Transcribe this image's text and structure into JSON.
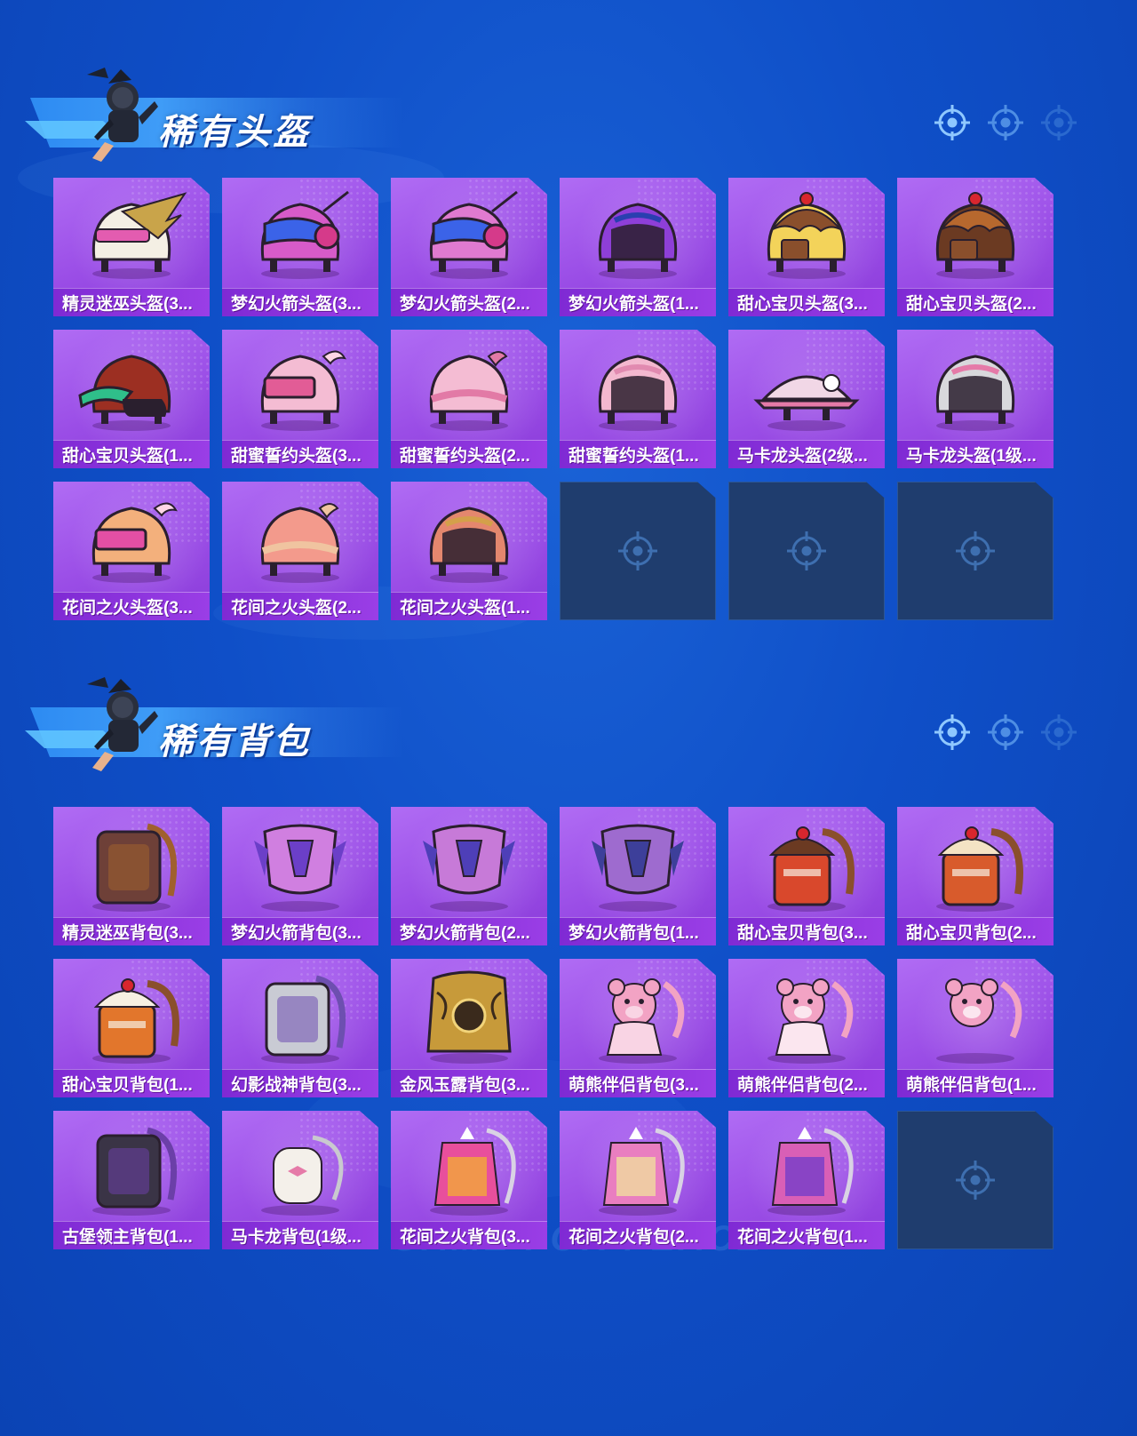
{
  "sections": [
    {
      "title": "稀有头盔",
      "items": [
        {
          "label": "精灵迷巫头盔(3...",
          "art": "helmet-wings",
          "c1": "#f4efe4",
          "c2": "#c9a44a"
        },
        {
          "label": "梦幻火箭头盔(3...",
          "art": "helmet-rocket",
          "c1": "#d75bc9",
          "c2": "#3b63e8"
        },
        {
          "label": "梦幻火箭头盔(2...",
          "art": "helmet-rocket",
          "c1": "#e07ad0",
          "c2": "#3b63e8"
        },
        {
          "label": "梦幻火箭头盔(1...",
          "art": "helmet-moto",
          "c1": "#8e3fd8",
          "c2": "#2a3fb0"
        },
        {
          "label": "甜心宝贝头盔(3...",
          "art": "helmet-cake",
          "c1": "#f3d35a",
          "c2": "#8a4f2c"
        },
        {
          "label": "甜心宝贝头盔(2...",
          "art": "helmet-cake",
          "c1": "#6b3a22",
          "c2": "#b7682e"
        },
        {
          "label": "甜心宝贝头盔(1...",
          "art": "helmet-cap",
          "c1": "#9c2f22",
          "c2": "#2fbf8a"
        },
        {
          "label": "甜蜜誓约头盔(3...",
          "art": "helmet-visor",
          "c1": "#f4bcd3",
          "c2": "#e25c96"
        },
        {
          "label": "甜蜜誓约头盔(2...",
          "art": "helmet-round",
          "c1": "#f4bcd3",
          "c2": "#e27aa6"
        },
        {
          "label": "甜蜜誓约头盔(1...",
          "art": "helmet-moto",
          "c1": "#f3b8cf",
          "c2": "#e18ab0"
        },
        {
          "label": "马卡龙头盔(2级...",
          "art": "helmet-flat",
          "c1": "#f1d7e6",
          "c2": "#e57aa8"
        },
        {
          "label": "马卡龙头盔(1级...",
          "art": "helmet-moto",
          "c1": "#d8d8dc",
          "c2": "#e57aa8"
        },
        {
          "label": "花间之火头盔(3...",
          "art": "helmet-visor",
          "c1": "#f3b07c",
          "c2": "#e34fa4"
        },
        {
          "label": "花间之火头盔(2...",
          "art": "helmet-round",
          "c1": "#f39a8c",
          "c2": "#f0c4a0"
        },
        {
          "label": "花间之火头盔(1...",
          "art": "helmet-moto",
          "c1": "#e4876e",
          "c2": "#d4a04a"
        },
        {
          "label": "",
          "empty": true
        },
        {
          "label": "",
          "empty": true
        },
        {
          "label": "",
          "empty": true
        }
      ]
    },
    {
      "title": "稀有背包",
      "items": [
        {
          "label": "精灵迷巫背包(3...",
          "art": "bag-box",
          "c1": "#6e4038",
          "c2": "#a0602e"
        },
        {
          "label": "梦幻火箭背包(3...",
          "art": "bag-rocket",
          "c1": "#d07fe0",
          "c2": "#6b3fc8"
        },
        {
          "label": "梦幻火箭背包(2...",
          "art": "bag-rocket",
          "c1": "#c77ad8",
          "c2": "#4e3fb8"
        },
        {
          "label": "梦幻火箭背包(1...",
          "art": "bag-rocket",
          "c1": "#9e6bcf",
          "c2": "#3d3f9a"
        },
        {
          "label": "甜心宝贝背包(3...",
          "art": "bag-cake",
          "c1": "#d9482c",
          "c2": "#6b3a22"
        },
        {
          "label": "甜心宝贝背包(2...",
          "art": "bag-cake",
          "c1": "#d85b2c",
          "c2": "#f4e3c4"
        },
        {
          "label": "甜心宝贝背包(1...",
          "art": "bag-cake",
          "c1": "#e2762c",
          "c2": "#f7efe2"
        },
        {
          "label": "幻影战神背包(3...",
          "art": "bag-box",
          "c1": "#c9cbd4",
          "c2": "#6d4fb0"
        },
        {
          "label": "金风玉露背包(3...",
          "art": "bag-ornate",
          "c1": "#c79a3a",
          "c2": "#3a2a1c"
        },
        {
          "label": "萌熊伴侣背包(3...",
          "art": "bag-bear",
          "c1": "#f2a3c4",
          "c2": "#f9d4e4"
        },
        {
          "label": "萌熊伴侣背包(2...",
          "art": "bag-bear",
          "c1": "#f2a3c4",
          "c2": "#fbe6ef"
        },
        {
          "label": "萌熊伴侣背包(1...",
          "art": "bag-bearhead",
          "c1": "#f2a3c4",
          "c2": "#fbe6ef"
        },
        {
          "label": "古堡领主背包(1...",
          "art": "bag-plain",
          "c1": "#3a3446",
          "c2": "#6b3fa8"
        },
        {
          "label": "马卡龙背包(1级...",
          "art": "bag-small",
          "c1": "#f4f0ea",
          "c2": "#e57aa8"
        },
        {
          "label": "花间之火背包(3...",
          "art": "bag-floral",
          "c1": "#e84f9c",
          "c2": "#f2a23e"
        },
        {
          "label": "花间之火背包(2...",
          "art": "bag-floral",
          "c1": "#e97ec0",
          "c2": "#f0d6a0"
        },
        {
          "label": "花间之火背包(1...",
          "art": "bag-pouch",
          "c1": "#d95fb6",
          "c2": "#7a3fc8"
        },
        {
          "label": "",
          "empty": true
        }
      ]
    }
  ],
  "watermark": "GAME FOR PEACE",
  "colors": {
    "card_purple": "#9a4de6",
    "label_purple": "#8a32dc",
    "empty_slot": "#1f3d6e",
    "background_blue": "#0f4fc8"
  }
}
